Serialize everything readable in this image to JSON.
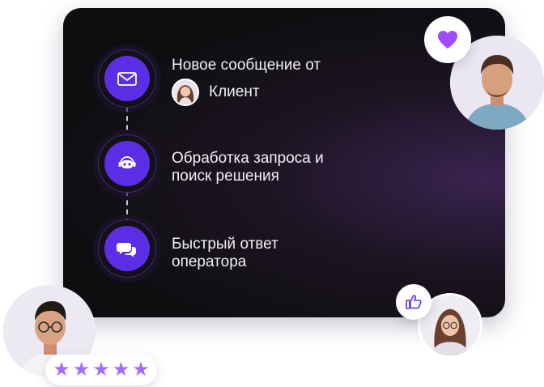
{
  "steps": [
    {
      "title": "Новое сообщение от",
      "icon": "envelope-icon"
    },
    {
      "title": "Обработка запроса и\nпоиск решения",
      "icon": "bot-headset-icon"
    },
    {
      "title": "Быстрый ответ\nоператора",
      "icon": "chat-bubbles-icon"
    }
  ],
  "client": {
    "label": "Клиент"
  },
  "rating": {
    "stars": 5,
    "max": 5
  },
  "bubbles": {
    "heart": "heart-icon",
    "like": "thumbs-up-icon"
  },
  "colors": {
    "accent": "#5b2ee6",
    "star": "#a26bff",
    "card": "#0e0e10"
  }
}
